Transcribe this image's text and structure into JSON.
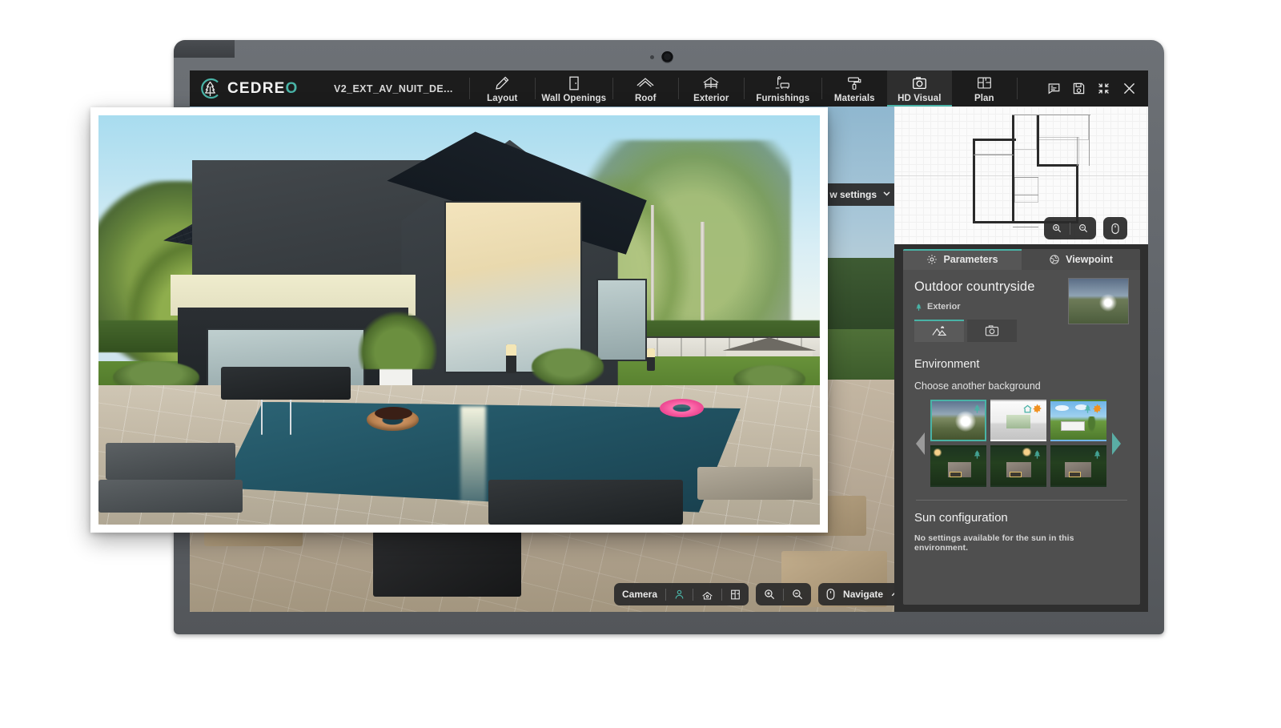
{
  "app": {
    "brand_main": "CEDRE",
    "brand_accent": "O",
    "project_name": "V2_EXT_AV_NUIT_DE...",
    "accent_color": "#49b3a6",
    "toolbar_bg": "#1c1c1c",
    "panel_bg": "#4f4f4f"
  },
  "toolbar": {
    "tools": [
      {
        "label": "Layout",
        "icon": "pencil-icon",
        "active": false
      },
      {
        "label": "Wall Openings",
        "icon": "door-icon",
        "active": false
      },
      {
        "label": "Roof",
        "icon": "roof-icon",
        "active": false
      },
      {
        "label": "Exterior",
        "icon": "gazebo-icon",
        "active": false
      },
      {
        "label": "Furnishings",
        "icon": "furniture-icon",
        "active": false
      },
      {
        "label": "Materials",
        "icon": "paint-roller-icon",
        "active": false
      },
      {
        "label": "HD Visual",
        "icon": "camera-icon",
        "active": true
      },
      {
        "label": "Plan",
        "icon": "blueprint-icon",
        "active": false
      }
    ],
    "window_buttons": [
      {
        "name": "comments-icon",
        "title": "Comments"
      },
      {
        "name": "save-icon",
        "title": "Save"
      },
      {
        "name": "collapse-icon",
        "title": "Collapse"
      },
      {
        "name": "close-icon",
        "title": "Close"
      }
    ]
  },
  "viewport": {
    "view_settings_label": "w settings",
    "view_settings_full": "View settings",
    "bottom_bar": {
      "camera_label": "Camera",
      "camera_buttons": [
        {
          "name": "person-view-icon"
        },
        {
          "name": "aerial-view-icon"
        },
        {
          "name": "plan-view-icon"
        }
      ],
      "zoom_buttons": [
        {
          "name": "zoom-in-icon"
        },
        {
          "name": "zoom-out-icon"
        }
      ],
      "navigate_label": "Navigate",
      "navigate_icon": "mouse-icon",
      "navigate_chevron": "chevron-up-icon"
    }
  },
  "minimap": {
    "name": "floor-plan-minimap",
    "tools": [
      {
        "name": "minimap-zoom-in-icon"
      },
      {
        "name": "minimap-zoom-out-icon"
      },
      {
        "name": "minimap-pan-icon"
      }
    ]
  },
  "panel": {
    "tabs": [
      {
        "label": "Parameters",
        "icon": "gear-icon",
        "active": true
      },
      {
        "label": "Viewpoint",
        "icon": "aperture-icon",
        "active": false
      }
    ],
    "environment_name": "Outdoor countryside",
    "environment_tag": "Exterior",
    "environment_tag_icon": "tree-icon",
    "sub_tabs": [
      {
        "name": "landscape-tab",
        "icon": "landscape-icon",
        "active": true
      },
      {
        "name": "camera-tab",
        "icon": "camera-icon",
        "active": false
      }
    ],
    "section_environment": "Environment",
    "choose_background_label": "Choose another background",
    "carousel": {
      "prev_icon": "chevron-left-icon",
      "prev_enabled": false,
      "next_icon": "chevron-right-icon",
      "next_enabled": true
    },
    "backgrounds": [
      {
        "name": "outdoor-countryside-thumb",
        "kind": "countryside-sunset",
        "selected": true,
        "badges": [
          "tree-badge"
        ]
      },
      {
        "name": "interior-room-thumb",
        "kind": "white-interior",
        "selected": false,
        "badges": [
          "house-badge",
          "sun-badge"
        ]
      },
      {
        "name": "suburban-day-thumb",
        "kind": "suburban-day",
        "selected": false,
        "badges": [
          "tree-badge",
          "sun-badge"
        ]
      },
      {
        "name": "night-exterior-1-thumb",
        "kind": "night-exterior",
        "selected": false,
        "badges": [
          "sun-badge",
          "tree-badge"
        ]
      },
      {
        "name": "night-exterior-2-thumb",
        "kind": "night-exterior",
        "selected": false,
        "badges": [
          "sun-badge",
          "tree-badge"
        ]
      },
      {
        "name": "night-exterior-3-thumb",
        "kind": "night-exterior",
        "selected": false,
        "badges": [
          "tree-badge"
        ]
      }
    ],
    "section_sun": "Sun configuration",
    "sun_note": "No settings available for the sun in this environment."
  },
  "render_popup": {
    "name": "hd-render-preview",
    "scene_description": "Modern dark-grey house with black tiled gable roof, large glazing, covered patio with dining set, swimming pool with donut float and pink ring float, sun loungers, trees and white fence."
  }
}
